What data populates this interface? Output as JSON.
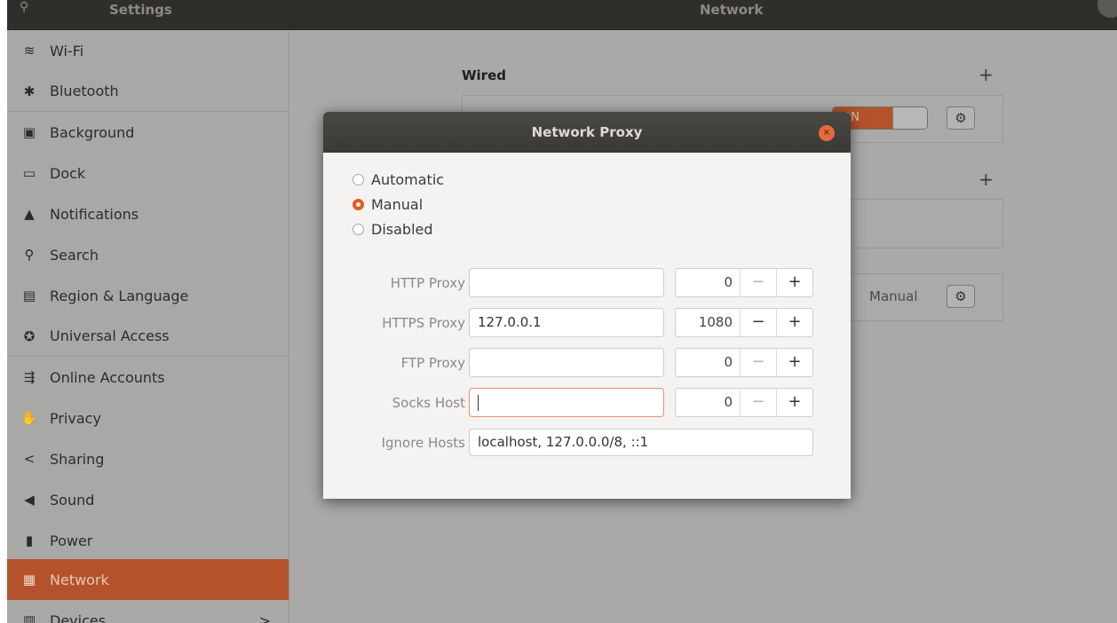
{
  "header": {
    "left_title": "Settings",
    "center_title": "Network"
  },
  "sidebar": {
    "items": [
      {
        "label": "Wi-Fi",
        "icon": "wifi-icon",
        "glyph": "≋"
      },
      {
        "label": "Bluetooth",
        "icon": "bluetooth-icon",
        "glyph": "✱"
      },
      {
        "label": "Background",
        "icon": "background-icon",
        "glyph": "▣"
      },
      {
        "label": "Dock",
        "icon": "dock-icon",
        "glyph": "▭"
      },
      {
        "label": "Notifications",
        "icon": "bell-icon",
        "glyph": "▲"
      },
      {
        "label": "Search",
        "icon": "search-icon",
        "glyph": "⚲"
      },
      {
        "label": "Region & Language",
        "icon": "region-icon",
        "glyph": "▤"
      },
      {
        "label": "Universal Access",
        "icon": "accessibility-icon",
        "glyph": "✪"
      },
      {
        "label": "Online Accounts",
        "icon": "online-accounts-icon",
        "glyph": "⇶"
      },
      {
        "label": "Privacy",
        "icon": "privacy-hand-icon",
        "glyph": "✋"
      },
      {
        "label": "Sharing",
        "icon": "share-icon",
        "glyph": "<"
      },
      {
        "label": "Sound",
        "icon": "speaker-icon",
        "glyph": "◀"
      },
      {
        "label": "Power",
        "icon": "power-icon",
        "glyph": "▮"
      },
      {
        "label": "Network",
        "icon": "network-icon",
        "glyph": "▦"
      },
      {
        "label": "Devices",
        "icon": "devices-icon",
        "glyph": "▥"
      }
    ],
    "active_index": 13,
    "devices_chevron": ">"
  },
  "main": {
    "wired_title": "Wired",
    "plus": "+",
    "switch_label": "ON",
    "proxy_state": "Manual"
  },
  "dialog": {
    "title": "Network Proxy",
    "close_glyph": "×",
    "methods": [
      {
        "label": "Automatic",
        "selected": false
      },
      {
        "label": "Manual",
        "selected": true
      },
      {
        "label": "Disabled",
        "selected": false
      }
    ],
    "rows": [
      {
        "label": "HTTP Proxy",
        "host": "",
        "port": "0"
      },
      {
        "label": "HTTPS Proxy",
        "host": "127.0.0.1",
        "port": "1080"
      },
      {
        "label": "FTP Proxy",
        "host": "",
        "port": "0"
      },
      {
        "label": "Socks Host",
        "host": "",
        "port": "0"
      }
    ],
    "ignore_label": "Ignore Hosts",
    "ignore_value": "localhost, 127.0.0.0/8, ::1",
    "minus": "−",
    "plus": "+"
  },
  "colors": {
    "accent": "#e45a1f",
    "sidebar_active": "#b4532b"
  }
}
